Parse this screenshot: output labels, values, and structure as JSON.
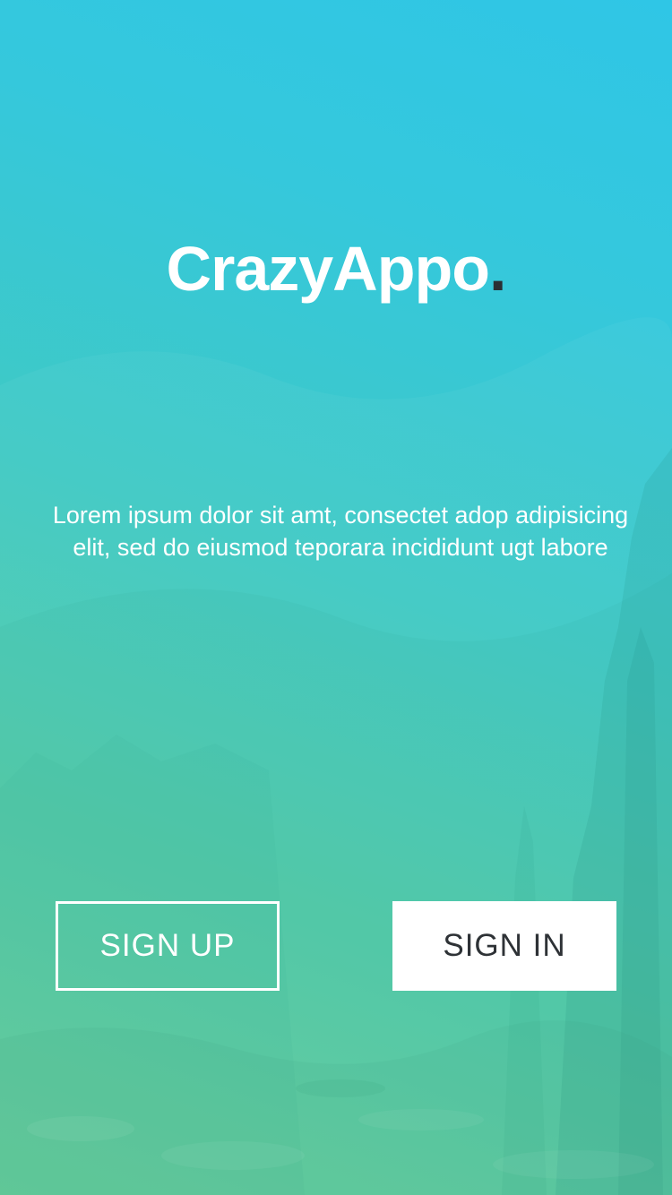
{
  "app": {
    "logo_text": "CrazyAppo",
    "logo_dot": "."
  },
  "intro": {
    "tagline": "Lorem ipsum dolor sit amt, consectet adop adipisicing elit, sed do eiusmod teporara incididunt ugt labore"
  },
  "actions": {
    "signup_label": "SIGN UP",
    "signin_label": "SIGN IN"
  },
  "colors": {
    "gradient_top": "#2fc6e6",
    "gradient_bottom": "#6ad49c",
    "logo_dot": "#2b2f33",
    "signin_text": "#2e3236"
  }
}
